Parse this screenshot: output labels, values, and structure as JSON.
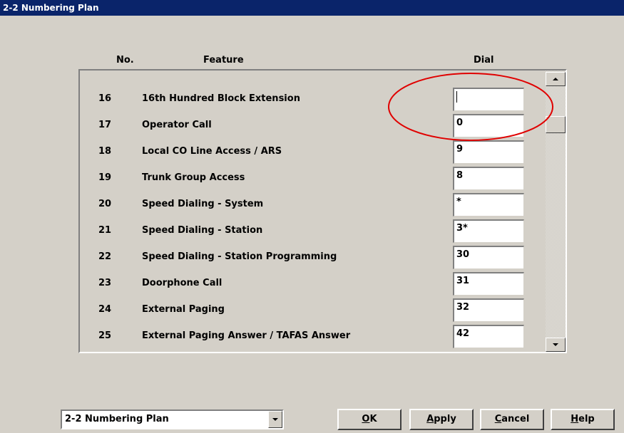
{
  "window": {
    "title": "2-2 Numbering Plan"
  },
  "table": {
    "headers": {
      "no": "No.",
      "feature": "Feature",
      "dial": "Dial"
    },
    "rows": [
      {
        "no": "16",
        "feature": "16th Hundred Block Extension",
        "dial": ""
      },
      {
        "no": "17",
        "feature": "Operator Call",
        "dial": "0"
      },
      {
        "no": "18",
        "feature": "Local CO Line Access / ARS",
        "dial": "9"
      },
      {
        "no": "19",
        "feature": "Trunk Group Access",
        "dial": "8"
      },
      {
        "no": "20",
        "feature": "Speed Dialing - System",
        "dial": "*"
      },
      {
        "no": "21",
        "feature": "Speed Dialing - Station",
        "dial": "3*"
      },
      {
        "no": "22",
        "feature": "Speed Dialing - Station Programming",
        "dial": "30"
      },
      {
        "no": "23",
        "feature": "Doorphone Call",
        "dial": "31"
      },
      {
        "no": "24",
        "feature": "External Paging",
        "dial": "32"
      },
      {
        "no": "25",
        "feature": "External Paging Answer / TAFAS Answer",
        "dial": "42"
      }
    ]
  },
  "footer": {
    "page_select": "2-2 Numbering Plan",
    "buttons": {
      "ok": {
        "pre": "",
        "mn": "O",
        "post": "K"
      },
      "apply": {
        "pre": "",
        "mn": "A",
        "post": "pply"
      },
      "cancel": {
        "pre": "",
        "mn": "C",
        "post": "ancel"
      },
      "help": {
        "pre": "",
        "mn": "H",
        "post": "elp"
      }
    }
  },
  "colors": {
    "title_bar": "#0a246a",
    "window_bg": "#d4d0c8",
    "annotation_circle": "#e00000"
  }
}
